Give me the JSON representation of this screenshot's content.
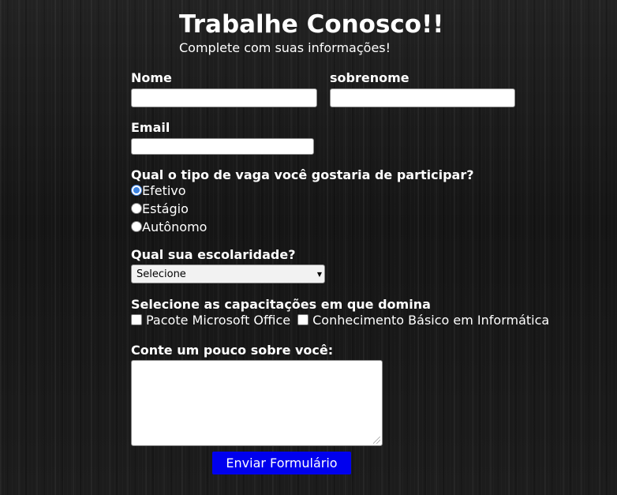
{
  "header": {
    "title": "Trabalhe Conosco!!",
    "subtitle": "Complete com suas informações!"
  },
  "form": {
    "name_label": "Nome",
    "surname_label": "sobrenome",
    "email_label": "Email",
    "name_value": "",
    "surname_value": "",
    "email_value": "",
    "job_type_question": "Qual o tipo de vaga você gostaria de participar?",
    "job_type_options": [
      {
        "label": "Efetivo",
        "checked": true
      },
      {
        "label": "Estágio",
        "checked": false
      },
      {
        "label": "Autônomo",
        "checked": false
      }
    ],
    "education_question": "Qual sua escolaridade?",
    "education_selected": "Selecione",
    "skills_question": "Selecione as capacitações em que domina",
    "skills_options": [
      {
        "label": "Pacote Microsoft Office",
        "checked": false
      },
      {
        "label": "Conhecimento Básico em Informática",
        "checked": false
      }
    ],
    "about_label": "Conte um pouco sobre você:",
    "about_value": "",
    "submit_label": "Enviar Formulário"
  },
  "colors": {
    "background": "#1a1a1a",
    "text": "#ffffff",
    "submit_button": "#0000ee",
    "radio_checked": "#3b82e0"
  },
  "icons": {
    "select_arrow": "chevron-down-icon",
    "textarea_grip": "resize-grip-icon"
  }
}
